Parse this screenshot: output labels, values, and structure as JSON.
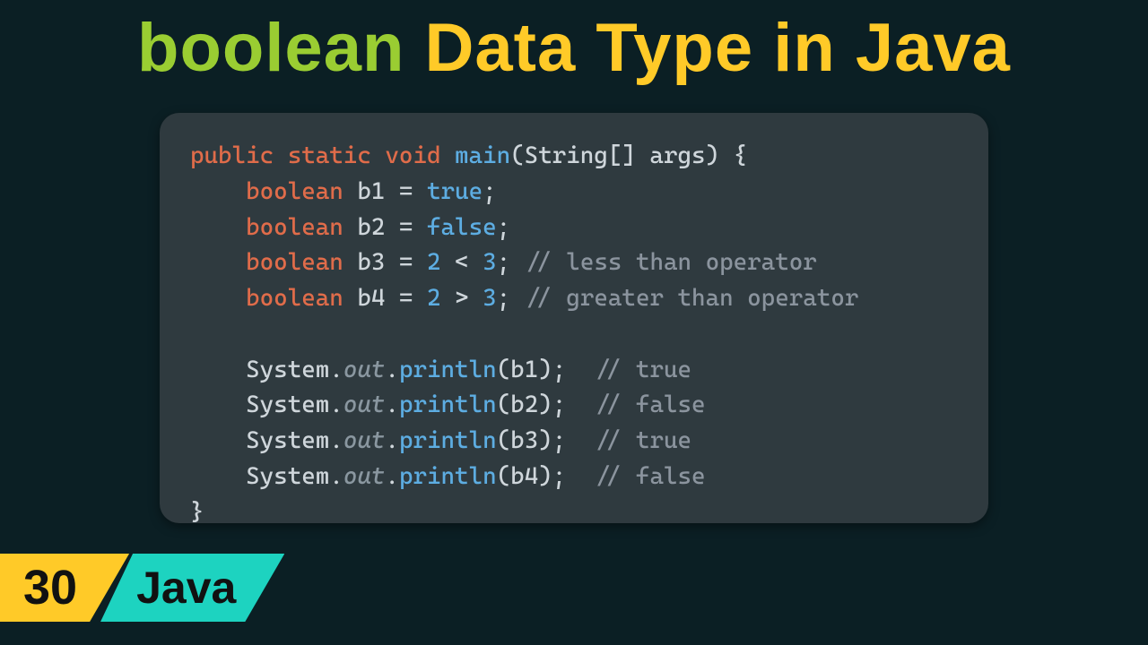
{
  "title": {
    "accent": "boolean",
    "rest": " Data Type in Java"
  },
  "badge": {
    "number": "30",
    "lang": "Java"
  },
  "code": {
    "sig_kw": "public static void ",
    "sig_fn": "main",
    "sig_args": "(String[] args) {",
    "l1_kw": "boolean",
    "l1_var": "b1",
    "l1_eq": " = ",
    "l1_val": "true",
    "l1_end": ";",
    "l2_kw": "boolean",
    "l2_var": "b2",
    "l2_eq": " = ",
    "l2_val": "false",
    "l2_end": ";",
    "l3_kw": "boolean",
    "l3_var": "b3",
    "l3_eq": " = ",
    "l3_a": "2",
    "l3_op": " < ",
    "l3_b": "3",
    "l3_end": "; ",
    "l3_c": "// less than operator",
    "l4_kw": "boolean",
    "l4_var": "b4",
    "l4_eq": " = ",
    "l4_a": "2",
    "l4_op": " > ",
    "l4_b": "3",
    "l4_end": "; ",
    "l4_c": "// greater than operator",
    "p_sys": "System",
    "p_dot1": ".",
    "p_out": "out",
    "p_dot2": ".",
    "p_fn": "println",
    "p1_arg": "(b1);  ",
    "p1_c": "// true",
    "p2_arg": "(b2);  ",
    "p2_c": "// false",
    "p3_arg": "(b3);  ",
    "p3_c": "// true",
    "p4_arg": "(b4);  ",
    "p4_c": "// false",
    "close": "}"
  }
}
